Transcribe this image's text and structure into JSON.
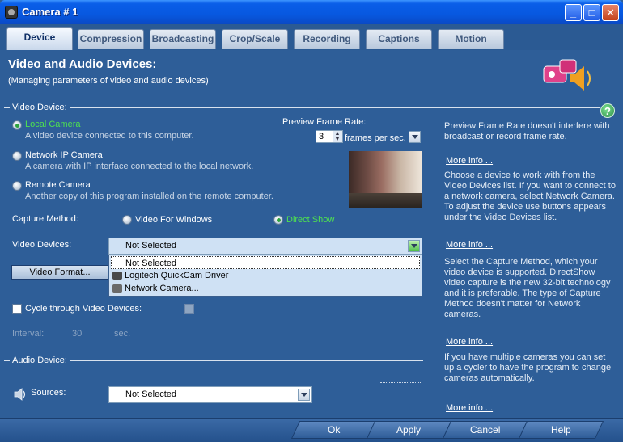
{
  "window": {
    "title": "Camera # 1",
    "minimize": "_",
    "maximize": "□",
    "close": "✕"
  },
  "tabs": [
    {
      "label": "Device",
      "active": true
    },
    {
      "label": "Compression"
    },
    {
      "label": "Broadcasting"
    },
    {
      "label": "Crop/Scale"
    },
    {
      "label": "Recording"
    },
    {
      "label": "Captions"
    },
    {
      "label": "Motion"
    }
  ],
  "header": {
    "title": "Video and Audio Devices:",
    "subtitle": "(Managing parameters of video and audio devices)"
  },
  "video_device": {
    "section_label": "Video Device:",
    "sources": [
      {
        "label": "Local Camera",
        "desc": "A video device connected to this computer.",
        "selected": true
      },
      {
        "label": "Network IP Camera",
        "desc": "A camera with IP interface connected to the local network."
      },
      {
        "label": "Remote Camera",
        "desc": "Another copy of this program installed on the remote computer."
      }
    ],
    "preview_rate_label": "Preview Frame Rate:",
    "preview_rate_value": "3",
    "preview_rate_unit": "frames per sec.",
    "capture_method_label": "Capture Method:",
    "capture_vfw": "Video For Windows",
    "capture_ds": "Direct Show",
    "devices_label": "Video Devices:",
    "devices_selected": "Not Selected",
    "devices_options": [
      "Not Selected",
      "Logitech QuickCam Driver",
      "Network Camera..."
    ],
    "video_format_button": "Video Format...",
    "cycle_label": "Cycle through Video Devices:",
    "interval_label": "Interval:",
    "interval_value": "30",
    "interval_unit": "sec."
  },
  "audio_device": {
    "section_label": "Audio Device:",
    "sources_label": "Sources:",
    "sources_selected": "Not Selected"
  },
  "help": {
    "p1": "Preview Frame Rate doesn't interfere with broadcast or record frame rate.",
    "p2": "Choose a device to work with from the Video Devices list. If you want to connect to a network camera, select Network Camera. To adjust the device use buttons appears under the Video Devices list.",
    "p3": "Select the Capture Method, which your video device is supported. DirectShow video capture is the new 32-bit technology and it is preferable. The type of Capture Method doesn't matter for Network cameras.",
    "p4": "If you have multiple cameras you can set up a cycler to have the program to change cameras automatically.",
    "more": "More info ..."
  },
  "footer": {
    "ok": "Ok",
    "apply": "Apply",
    "cancel": "Cancel",
    "help": "Help"
  }
}
